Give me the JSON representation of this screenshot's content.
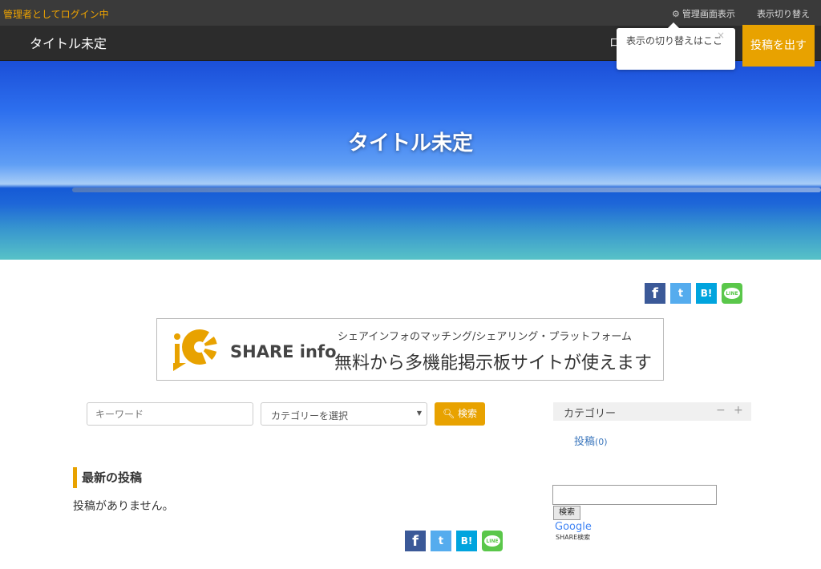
{
  "adminbar": {
    "login_status": "管理者としてログイン中",
    "manage_view": "管理画面表示",
    "switch_view": "表示切り替え"
  },
  "header": {
    "site_title": "タイトル未定",
    "partial_menu": "ロ"
  },
  "tooltip": {
    "text": "表示の切り替えはここ",
    "close": "×"
  },
  "post_button": "投稿を出す",
  "hero": {
    "title": "タイトル未定"
  },
  "share_icons": {
    "facebook": "f",
    "twitter": "t",
    "hatena": "B!",
    "line": "LINE"
  },
  "banner": {
    "brand": "SHARE info",
    "subtitle": "シェアインフォのマッチング/シェアリング・プラットフォーム",
    "main": "無料から多機能掲示板サイトが使えます"
  },
  "search": {
    "keyword_placeholder": "キーワード",
    "category_select": "カテゴリーを選択",
    "button": "検索"
  },
  "latest": {
    "title": "最新の投稿",
    "empty": "投稿がありません。"
  },
  "sidebar": {
    "category_title": "カテゴリー",
    "collapse": "−",
    "expand": "+",
    "category_item": "投稿",
    "category_count": "(0)"
  },
  "google": {
    "button": "検索",
    "logo": "Google",
    "sub": "SHARE検索"
  },
  "colors": {
    "accent": "#e8a200",
    "facebook": "#3b5998",
    "twitter": "#55acee",
    "hatena": "#00a4de",
    "line": "#5ac74a"
  }
}
